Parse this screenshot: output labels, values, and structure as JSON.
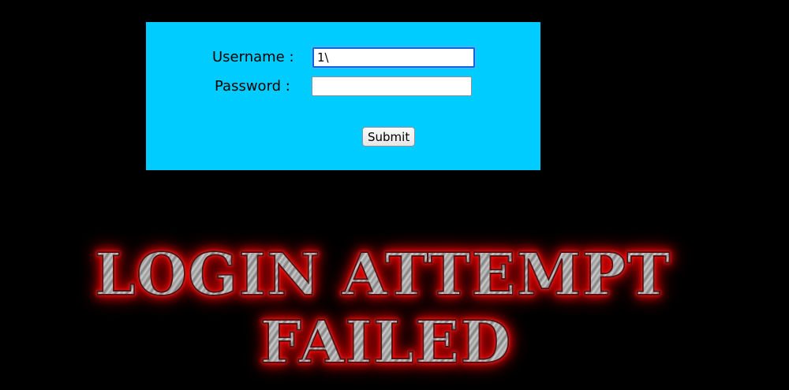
{
  "login_form": {
    "username_label": "Username :",
    "password_label": "Password :",
    "username_value": "1\\",
    "password_value": "",
    "submit_label": "Submit"
  },
  "banner": {
    "line1": "LOGIN ATTEMPT",
    "line2": "FAILED"
  },
  "colors": {
    "background": "#000000",
    "panel": "#00ccff",
    "banner_glow": "#e00000",
    "banner_metal": "#a8a8a8"
  }
}
